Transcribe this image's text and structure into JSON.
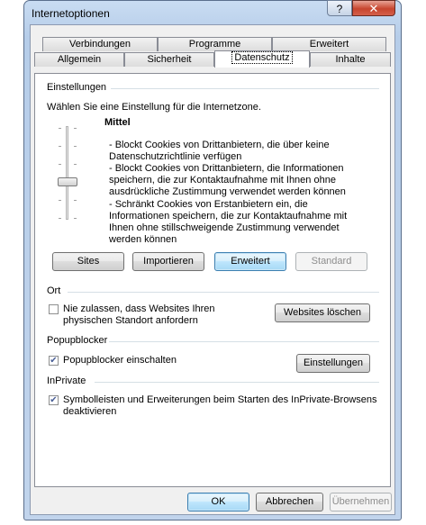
{
  "window": {
    "title": "Internetoptionen",
    "help_label": "?",
    "close_label": "✕"
  },
  "tabs_row1": [
    "Verbindungen",
    "Programme",
    "Erweitert"
  ],
  "tabs_row2": [
    "Allgemein",
    "Sicherheit",
    "Datenschutz",
    "Inhalte"
  ],
  "active_tab": "Datenschutz",
  "settings": {
    "group": "Einstellungen",
    "instruction": "Wählen Sie eine Einstellung für die Internetzone.",
    "level": "Mittel",
    "desc1": "- Blockt Cookies von Drittanbietern, die über keine Datenschutzrichtlinie verfügen",
    "desc2": "- Blockt Cookies von Drittanbietern, die Informationen speichern, die zur Kontaktaufnahme mit Ihnen ohne ausdrückliche Zustimmung verwendet werden können",
    "desc3": "- Schränkt Cookies von Erstanbietern ein, die Informationen speichern, die zur Kontaktaufnahme mit Ihnen ohne stillschweigende Zustimmung verwendet werden können",
    "buttons": {
      "sites": "Sites",
      "import": "Importieren",
      "advanced": "Erweitert",
      "default": "Standard"
    }
  },
  "location": {
    "group": "Ort",
    "checkbox_label": "Nie zulassen, dass Websites Ihren physischen Standort anfordern",
    "checked": false,
    "clear_button": "Websites löschen"
  },
  "popup": {
    "group": "Popupblocker",
    "checkbox_label": "Popupblocker einschalten",
    "checked": true,
    "settings_button": "Einstellungen"
  },
  "inprivate": {
    "group": "InPrivate",
    "checkbox_label": "Symbolleisten und Erweiterungen beim Starten des InPrivate-Browsens deaktivieren",
    "checked": true
  },
  "footer": {
    "ok": "OK",
    "cancel": "Abbrechen",
    "apply": "Übernehmen"
  },
  "check_glyph": "✔"
}
